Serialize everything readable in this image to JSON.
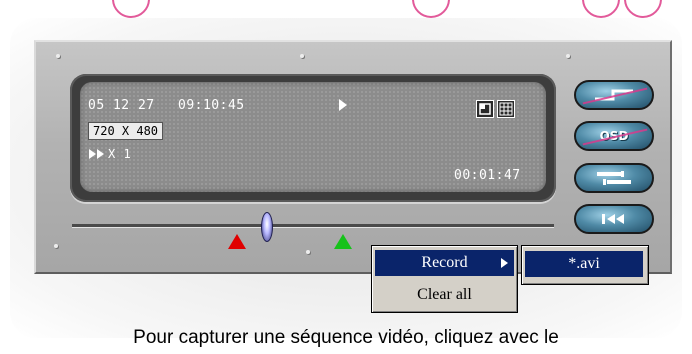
{
  "lcd": {
    "date": "05 12 27",
    "time": "09:10:45",
    "resolution": "720 X 480",
    "speed": "X 1",
    "elapsed": "00:01:47",
    "play_icon": "play-icon",
    "speed_icon": "fast-forward-icon"
  },
  "buttons": {
    "zoom": "zoom-icon",
    "osd": "OSD",
    "settings": "settings-icon",
    "rewind": "rewind-to-start-icon"
  },
  "context_menu": {
    "record": "Record",
    "clear_all": "Clear all"
  },
  "submenu": {
    "avi": "*.avi"
  },
  "caption": "Pour capturer une séquence vidéo, cliquez avec le",
  "colors": {
    "menu_highlight": "#0a246a",
    "marker_start": "#e00000",
    "marker_end": "#16c21a",
    "button_blue": "#4f8aa6"
  }
}
